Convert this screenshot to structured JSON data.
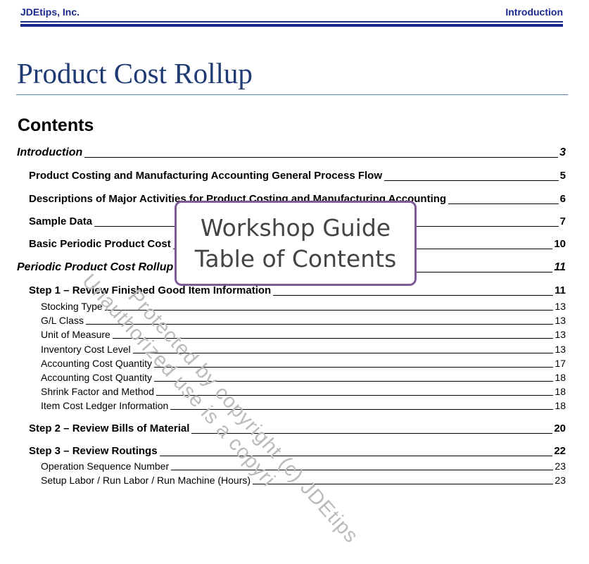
{
  "header": {
    "company": "JDEtips, Inc.",
    "section": "Introduction"
  },
  "title": "Product Cost Rollup",
  "contents_heading": "Contents",
  "toc": [
    {
      "label": "Introduction",
      "page": "3",
      "level": 1
    },
    {
      "label": "Product Costing and Manufacturing Accounting General Process Flow",
      "page": "5",
      "level": 2
    },
    {
      "label": "Descriptions of Major Activities for Product Costing and Manufacturing Accounting",
      "page": "6",
      "level": 2
    },
    {
      "label": "Sample Data",
      "page": "7",
      "level": 2
    },
    {
      "label": "Basic Periodic Product Cost",
      "page": "10",
      "level": 2
    },
    {
      "label": "Periodic Product Cost Rollup",
      "page": "11",
      "level": 1
    },
    {
      "label": "Step 1 – Review Finished Good Item Information",
      "page": "11",
      "level": 2
    },
    {
      "label": "Stocking Type",
      "page": "13",
      "level": 3
    },
    {
      "label": "G/L Class",
      "page": "13",
      "level": 3
    },
    {
      "label": "Unit of Measure",
      "page": "13",
      "level": 3
    },
    {
      "label": "Inventory Cost Level",
      "page": "13",
      "level": 3
    },
    {
      "label": "Accounting Cost Quantity",
      "page": "17",
      "level": 3
    },
    {
      "label": "Accounting Cost Quantity",
      "page": "18",
      "level": 3
    },
    {
      "label": "Shrink Factor and Method",
      "page": "18",
      "level": 3
    },
    {
      "label": "Item Cost Ledger Information",
      "page": "18",
      "level": 3
    },
    {
      "label": "Step 2 – Review Bills of Material",
      "page": "20",
      "level": 2
    },
    {
      "label": "Step 3 – Review Routings",
      "page": "22",
      "level": 2
    },
    {
      "label": "Operation Sequence Number",
      "page": "23",
      "level": 3
    },
    {
      "label": "Setup Labor / Run Labor / Run Machine (Hours)",
      "page": "23",
      "level": 3
    }
  ],
  "watermark": {
    "line1": "Protected by copyright (c) JDEtips",
    "line2": "Unauthorized use is a copyri"
  },
  "overlay": {
    "line1": "Workshop Guide",
    "line2": "Table of Contents"
  }
}
